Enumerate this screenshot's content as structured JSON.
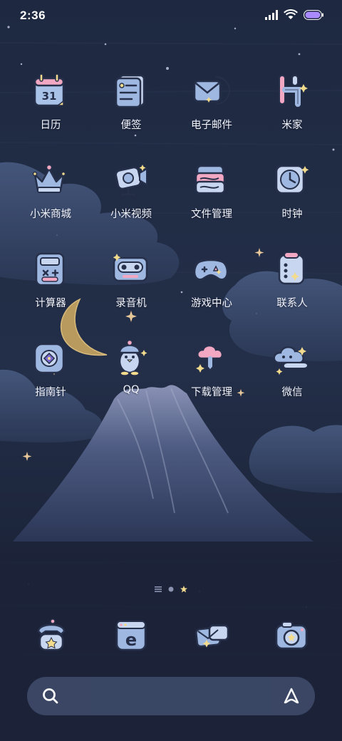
{
  "status_bar": {
    "time": "2:36",
    "icons": [
      "signal-icon",
      "wifi-icon",
      "battery-icon"
    ],
    "battery_color": "#a98bff"
  },
  "apps": [
    {
      "label": "日历",
      "icon": "calendar-icon",
      "calendar_day": "31"
    },
    {
      "label": "便签",
      "icon": "notes-icon"
    },
    {
      "label": "电子邮件",
      "icon": "email-icon"
    },
    {
      "label": "米家",
      "icon": "mijia-icon"
    },
    {
      "label": "小米商城",
      "icon": "crown-icon"
    },
    {
      "label": "小米视频",
      "icon": "video-camera-icon"
    },
    {
      "label": "文件管理",
      "icon": "file-manager-icon"
    },
    {
      "label": "时钟",
      "icon": "clock-icon"
    },
    {
      "label": "计算器",
      "icon": "calculator-icon"
    },
    {
      "label": "录音机",
      "icon": "recorder-icon"
    },
    {
      "label": "游戏中心",
      "icon": "gamepad-icon"
    },
    {
      "label": "联系人",
      "icon": "contacts-icon"
    },
    {
      "label": "指南针",
      "icon": "compass-icon"
    },
    {
      "label": "QQ",
      "icon": "qq-penguin-icon"
    },
    {
      "label": "下载管理",
      "icon": "download-cloud-icon"
    },
    {
      "label": "微信",
      "icon": "wechat-cloud-icon"
    }
  ],
  "page_indicator": {
    "pages": [
      "list-icon",
      "dot-icon",
      "star-icon"
    ],
    "active": 2
  },
  "dock": [
    {
      "icon": "phone-icon"
    },
    {
      "icon": "browser-icon",
      "letter": "e"
    },
    {
      "icon": "messages-icon"
    },
    {
      "icon": "camera-icon"
    }
  ],
  "search_bar": {
    "left_icon": "search-icon",
    "right_icon": "assistant-icon"
  },
  "colors": {
    "sky": "#1d2740",
    "icon_fill": "#9fb8e2",
    "icon_stroke": "#27304a",
    "accent_yellow": "#f3db8e",
    "accent_pink": "#f2a8c3",
    "search_bar": "#3b4866"
  }
}
